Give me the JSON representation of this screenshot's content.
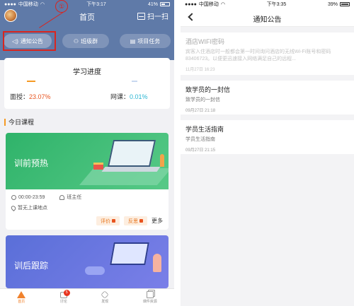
{
  "left": {
    "status": {
      "carrier": "中国移动",
      "time": "下午3:17",
      "battery": "41%"
    },
    "header": {
      "title": "首页",
      "scan_label": "扫一扫",
      "annotation": "①"
    },
    "pills": [
      {
        "label": "通知公告",
        "icon": "megaphone-icon"
      },
      {
        "label": "班级群",
        "icon": "group-icon"
      },
      {
        "label": "项目任务",
        "icon": "task-icon"
      }
    ],
    "progress": {
      "title": "学习进度",
      "face_label": "面授：",
      "face_value": "23.07%",
      "online_label": "网课：",
      "online_value": "0.01%"
    },
    "section_title": "今日课程",
    "course1": {
      "name": "训前预热",
      "time": "00:00-23:59",
      "teacher": "班主任",
      "location": "暂无上课地点",
      "rate": "评价",
      "feedback": "反思",
      "more": "更多"
    },
    "course2": {
      "name": "训后跟踪"
    },
    "tabs": [
      {
        "label": "首页",
        "active": true
      },
      {
        "label": "讨论",
        "badge": "5"
      },
      {
        "label": "发现"
      },
      {
        "label": "课件资源"
      }
    ]
  },
  "right": {
    "status": {
      "carrier": "中国移动",
      "time": "下午3:35",
      "battery": "39%"
    },
    "nav": {
      "title": "通知公告"
    },
    "notices": [
      {
        "title": "酒店WIFI密码",
        "desc": "宾客入住酒店时一般都会第一时间询问酒店的无线Wi-Fi账号和密码83406723。以便更迅速接入网络满足自己的远程...",
        "time": "11月27日 16:23"
      },
      {
        "title": "致学员的一封信",
        "desc": "致学员的一封信",
        "time": "09月27日 21:18"
      },
      {
        "title": "学员生活指南",
        "desc": "学员生活指南",
        "time": "09月27日 21:15"
      }
    ]
  }
}
